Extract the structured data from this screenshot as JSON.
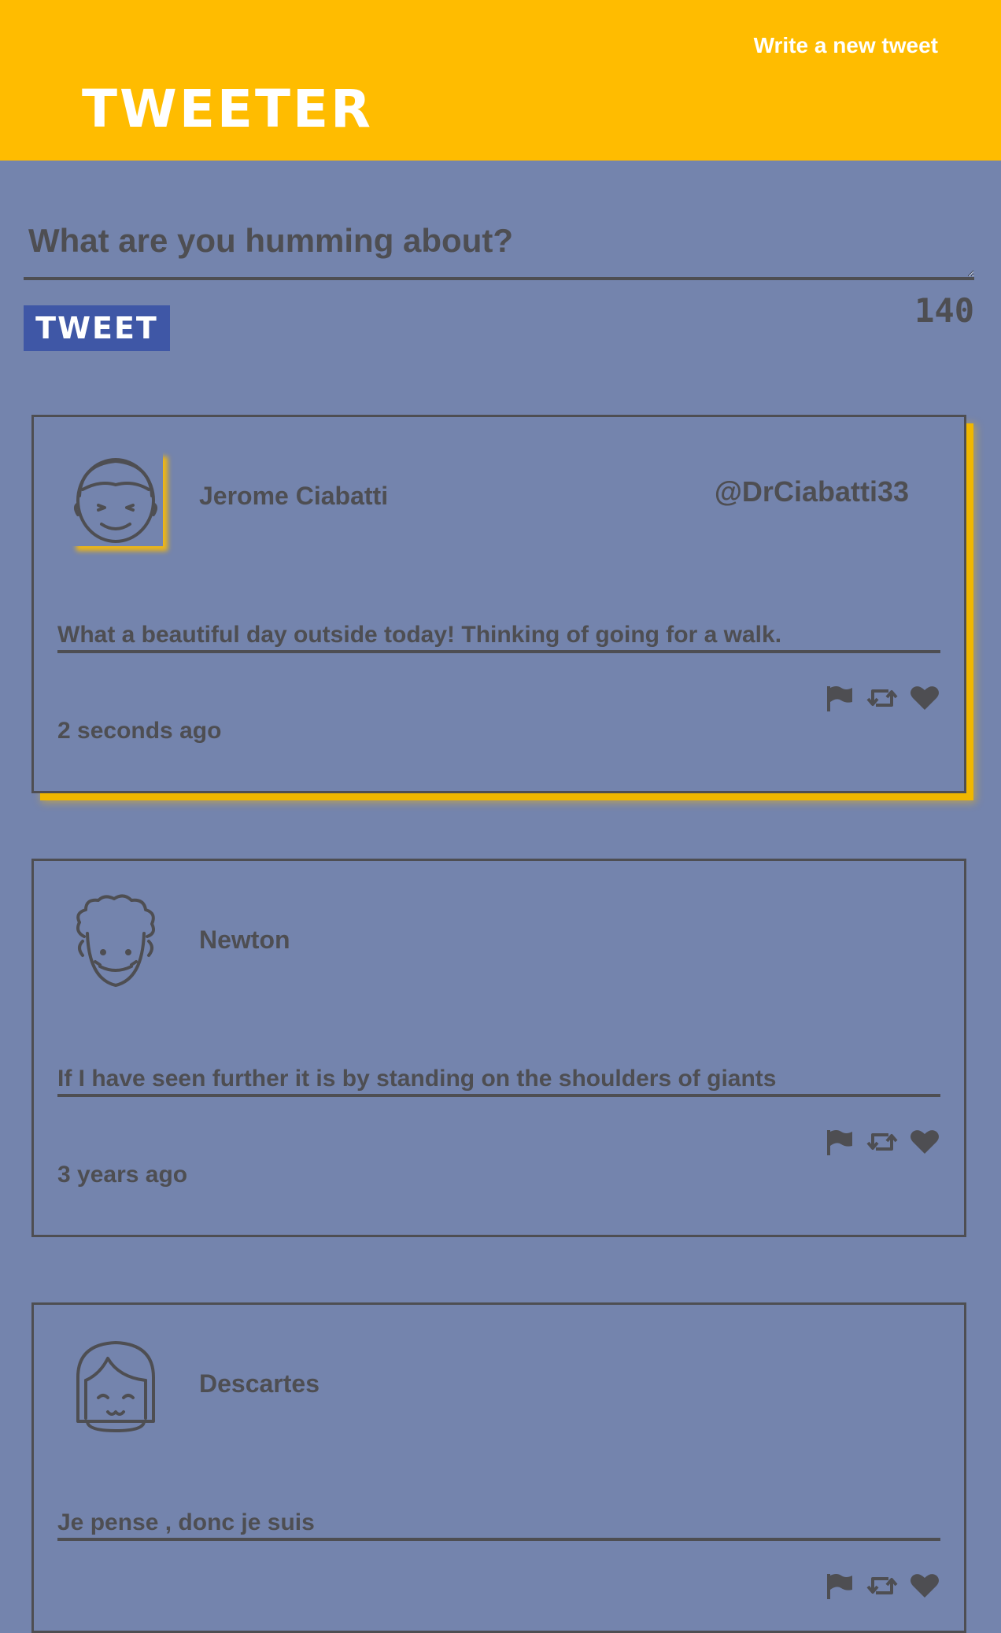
{
  "nav": {
    "brand": "TWEETER",
    "write_link": "Write a new tweet",
    "color": "#ffbc00"
  },
  "compose": {
    "placeholder": "What are you humming about?",
    "value": "",
    "button_label": "TWEET",
    "counter": "140"
  },
  "tweets": [
    {
      "name": "Jerome Ciabatti",
      "handle": "@DrCiabatti33",
      "content": "What a beautiful day outside today! Thinking of going for a walk.",
      "timestamp": "2 seconds ago",
      "avatar": "smiling-face-icon",
      "highlighted": true
    },
    {
      "name": "Newton",
      "handle": "",
      "content": "If I have seen further it is by standing on the shoulders of giants",
      "timestamp": "3 years ago",
      "avatar": "curly-hair-face-icon",
      "highlighted": false
    },
    {
      "name": "Descartes",
      "handle": "",
      "content": "Je pense , donc je suis",
      "timestamp": "",
      "avatar": "bob-hair-face-icon",
      "highlighted": false
    }
  ],
  "icons": {
    "flag": "flag-icon",
    "retweet": "retweet-icon",
    "like": "heart-icon"
  },
  "colors": {
    "background": "#7484ad",
    "accent": "#ffbc00",
    "button": "#3f57a6",
    "text": "#4e4e52"
  }
}
